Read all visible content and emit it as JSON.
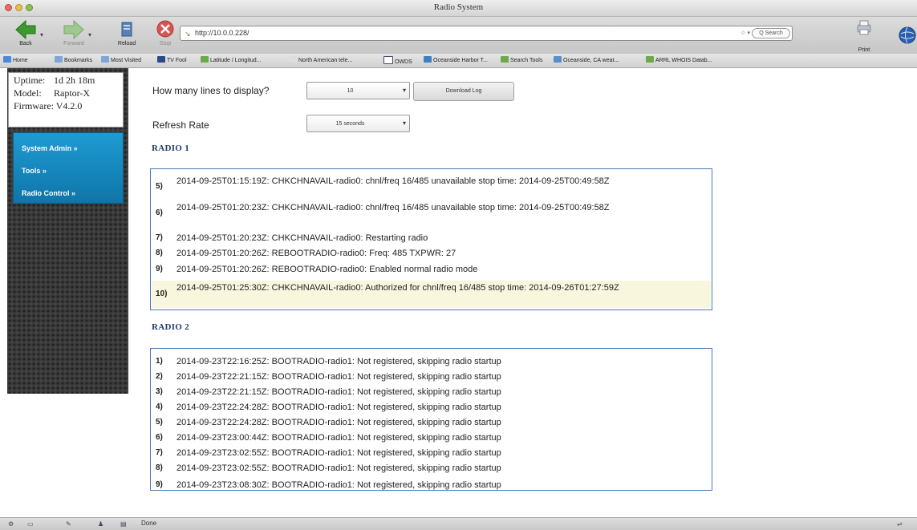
{
  "window": {
    "title": "Radio System",
    "colors": {
      "close": "#e96b5c",
      "minimize": "#e7bf47",
      "zoom": "#8cc152"
    }
  },
  "toolbar": {
    "back_label": "Back",
    "forward_label": "Forward",
    "reload_label": "Reload",
    "stop_label": "Stop",
    "url": "http://10.0.0.228/",
    "search_placeholder": "Q Search",
    "print_label": "Print"
  },
  "bookmarks": [
    {
      "label": "Home",
      "icon": "home-icon"
    },
    {
      "label": "Bookmarks",
      "icon": "bookmarks-icon"
    },
    {
      "label": "Most Visited",
      "icon": "folder-icon"
    },
    {
      "label": "TV Fool",
      "icon": "tv-icon"
    },
    {
      "label": "Latitude / Longitud...",
      "icon": "link-icon"
    },
    {
      "label": "North American tele...",
      "icon": "wiki-icon"
    },
    {
      "label": "OWDS",
      "icon": "page-icon"
    },
    {
      "label": "Oceanside Harbor T...",
      "icon": "harbor-icon"
    },
    {
      "label": "Search Tools",
      "icon": "link-icon"
    },
    {
      "label": "Oceanside, CA weat...",
      "icon": "weather-icon"
    },
    {
      "label": "ARRL WHOIS Datab...",
      "icon": "link-icon"
    }
  ],
  "info": {
    "uptime_label": "Uptime:",
    "uptime_value": "1d 2h 18m",
    "model_label": "Model:",
    "model_value": "Raptor-X",
    "firmware_text": "Firmware: V4.2.0"
  },
  "nav": {
    "system_admin": "System Admin »",
    "tools": "Tools »",
    "radio_control": "Radio Control »"
  },
  "form": {
    "lines_label": "How many lines to display?",
    "lines_value": "10",
    "download_label": "Download Log",
    "refresh_label": "Refresh Rate",
    "refresh_value": "15 seconds"
  },
  "radio1": {
    "heading": "RADIO 1",
    "entries": [
      {
        "num": "5)",
        "text": "2014-09-25T01:15:19Z: CHKCHNAVAIL-radio0: chnl/freq 16/485 unavailable stop time: 2014-09-25T00:49:58Z"
      },
      {
        "num": "6)",
        "text": "2014-09-25T01:20:23Z: CHKCHNAVAIL-radio0: chnl/freq 16/485 unavailable stop time: 2014-09-25T00:49:58Z"
      },
      {
        "num": "7)",
        "text": "2014-09-25T01:20:23Z: CHKCHNAVAIL-radio0: Restarting radio"
      },
      {
        "num": "8)",
        "text": "2014-09-25T01:20:26Z: REBOOTRADIO-radio0: Freq: 485 TXPWR: 27"
      },
      {
        "num": "9)",
        "text": "2014-09-25T01:20:26Z: REBOOTRADIO-radio0: Enabled normal radio mode"
      },
      {
        "num": "10)",
        "text": "2014-09-25T01:25:30Z: CHKCHNAVAIL-radio0: Authorized for chnl/freq 16/485 stop time: 2014-09-26T01:27:59Z"
      }
    ]
  },
  "radio2": {
    "heading": "RADIO 2",
    "entries": [
      {
        "num": "1)",
        "text": "2014-09-23T22:16:25Z: BOOTRADIO-radio1: Not registered, skipping radio startup"
      },
      {
        "num": "2)",
        "text": "2014-09-23T22:21:15Z: BOOTRADIO-radio1: Not registered, skipping radio startup"
      },
      {
        "num": "3)",
        "text": "2014-09-23T22:21:15Z: BOOTRADIO-radio1: Not registered, skipping radio startup"
      },
      {
        "num": "4)",
        "text": "2014-09-23T22:24:28Z: BOOTRADIO-radio1: Not registered, skipping radio startup"
      },
      {
        "num": "5)",
        "text": "2014-09-23T22:24:28Z: BOOTRADIO-radio1: Not registered, skipping radio startup"
      },
      {
        "num": "6)",
        "text": "2014-09-23T23:00:44Z: BOOTRADIO-radio1: Not registered, skipping radio startup"
      },
      {
        "num": "7)",
        "text": "2014-09-23T23:02:55Z: BOOTRADIO-radio1: Not registered, skipping radio startup"
      },
      {
        "num": "8)",
        "text": "2014-09-23T23:02:55Z: BOOTRADIO-radio1: Not registered, skipping radio startup"
      },
      {
        "num": "9)",
        "text": "2014-09-23T23:08:30Z: BOOTRADIO-radio1: Not registered, skipping radio startup"
      }
    ]
  },
  "statusbar": {
    "status": "Done"
  }
}
